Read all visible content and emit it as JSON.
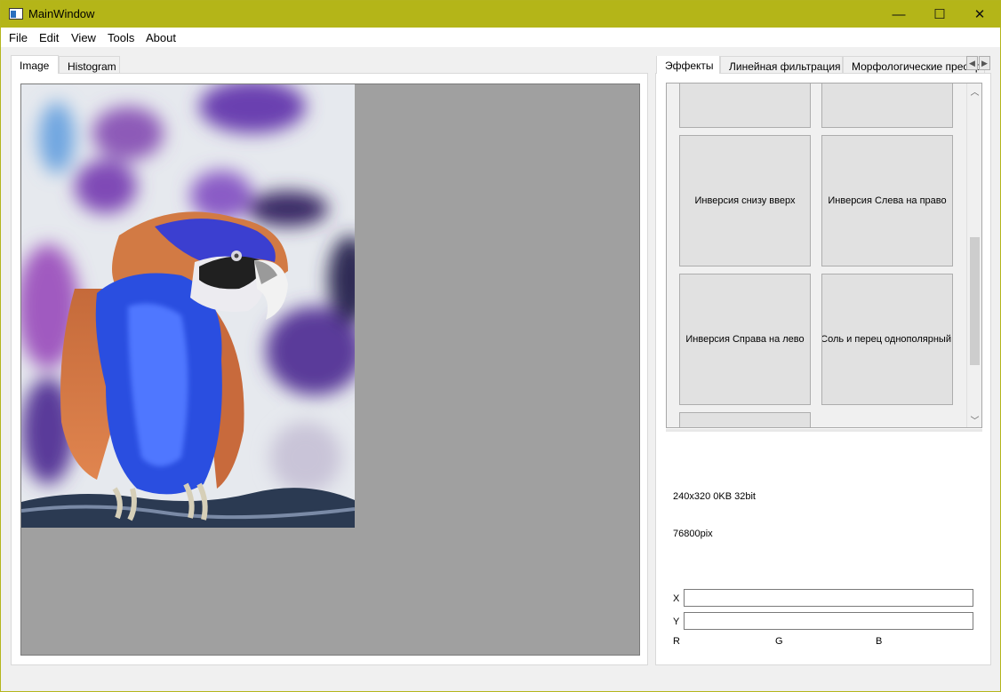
{
  "window": {
    "title": "MainWindow",
    "minimize": "—",
    "maximize": "☐",
    "close": "✕"
  },
  "menu": [
    "File",
    "Edit",
    "View",
    "Tools",
    "About"
  ],
  "left_tabs": [
    "Image",
    "Histogram"
  ],
  "right_tabs": [
    "Эффекты",
    "Линейная фильтрация",
    "Морфологические преобр"
  ],
  "effects": {
    "buttons": [
      "Инверсия снизу вверх",
      "Инверсия Слева на право",
      "Инверсия Справа на лево",
      "Соль и перец однополярный"
    ]
  },
  "info": {
    "image_stats": "240x320 0KB 32bit",
    "pixels": "76800pix"
  },
  "coords": {
    "x_label": "X",
    "y_label": "Y",
    "x_value": "",
    "y_value": ""
  },
  "rgb": {
    "r": "R",
    "g": "G",
    "b": "B"
  },
  "colors": {
    "titlebar": "#b4b518",
    "canvas_bg": "#a0a0a0"
  }
}
